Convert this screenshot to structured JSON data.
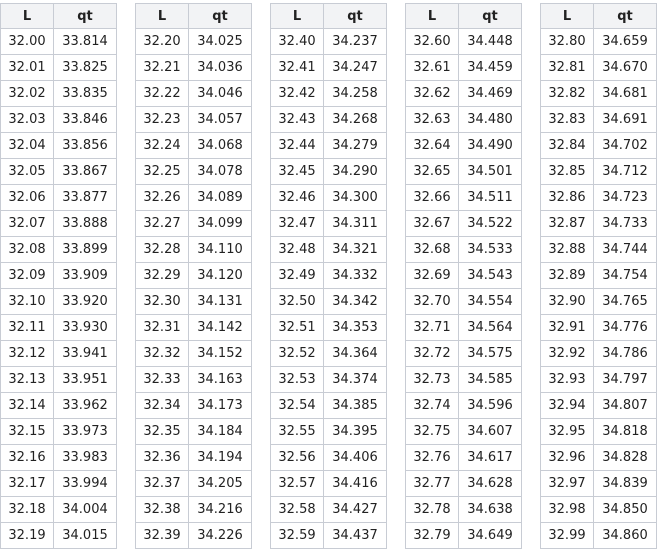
{
  "headers": {
    "l": "L",
    "qt": "qt"
  },
  "tables": [
    {
      "rows": [
        [
          "32.00",
          "33.814"
        ],
        [
          "32.01",
          "33.825"
        ],
        [
          "32.02",
          "33.835"
        ],
        [
          "32.03",
          "33.846"
        ],
        [
          "32.04",
          "33.856"
        ],
        [
          "32.05",
          "33.867"
        ],
        [
          "32.06",
          "33.877"
        ],
        [
          "32.07",
          "33.888"
        ],
        [
          "32.08",
          "33.899"
        ],
        [
          "32.09",
          "33.909"
        ],
        [
          "32.10",
          "33.920"
        ],
        [
          "32.11",
          "33.930"
        ],
        [
          "32.12",
          "33.941"
        ],
        [
          "32.13",
          "33.951"
        ],
        [
          "32.14",
          "33.962"
        ],
        [
          "32.15",
          "33.973"
        ],
        [
          "32.16",
          "33.983"
        ],
        [
          "32.17",
          "33.994"
        ],
        [
          "32.18",
          "34.004"
        ],
        [
          "32.19",
          "34.015"
        ]
      ]
    },
    {
      "rows": [
        [
          "32.20",
          "34.025"
        ],
        [
          "32.21",
          "34.036"
        ],
        [
          "32.22",
          "34.046"
        ],
        [
          "32.23",
          "34.057"
        ],
        [
          "32.24",
          "34.068"
        ],
        [
          "32.25",
          "34.078"
        ],
        [
          "32.26",
          "34.089"
        ],
        [
          "32.27",
          "34.099"
        ],
        [
          "32.28",
          "34.110"
        ],
        [
          "32.29",
          "34.120"
        ],
        [
          "32.30",
          "34.131"
        ],
        [
          "32.31",
          "34.142"
        ],
        [
          "32.32",
          "34.152"
        ],
        [
          "32.33",
          "34.163"
        ],
        [
          "32.34",
          "34.173"
        ],
        [
          "32.35",
          "34.184"
        ],
        [
          "32.36",
          "34.194"
        ],
        [
          "32.37",
          "34.205"
        ],
        [
          "32.38",
          "34.216"
        ],
        [
          "32.39",
          "34.226"
        ]
      ]
    },
    {
      "rows": [
        [
          "32.40",
          "34.237"
        ],
        [
          "32.41",
          "34.247"
        ],
        [
          "32.42",
          "34.258"
        ],
        [
          "32.43",
          "34.268"
        ],
        [
          "32.44",
          "34.279"
        ],
        [
          "32.45",
          "34.290"
        ],
        [
          "32.46",
          "34.300"
        ],
        [
          "32.47",
          "34.311"
        ],
        [
          "32.48",
          "34.321"
        ],
        [
          "32.49",
          "34.332"
        ],
        [
          "32.50",
          "34.342"
        ],
        [
          "32.51",
          "34.353"
        ],
        [
          "32.52",
          "34.364"
        ],
        [
          "32.53",
          "34.374"
        ],
        [
          "32.54",
          "34.385"
        ],
        [
          "32.55",
          "34.395"
        ],
        [
          "32.56",
          "34.406"
        ],
        [
          "32.57",
          "34.416"
        ],
        [
          "32.58",
          "34.427"
        ],
        [
          "32.59",
          "34.437"
        ]
      ]
    },
    {
      "rows": [
        [
          "32.60",
          "34.448"
        ],
        [
          "32.61",
          "34.459"
        ],
        [
          "32.62",
          "34.469"
        ],
        [
          "32.63",
          "34.480"
        ],
        [
          "32.64",
          "34.490"
        ],
        [
          "32.65",
          "34.501"
        ],
        [
          "32.66",
          "34.511"
        ],
        [
          "32.67",
          "34.522"
        ],
        [
          "32.68",
          "34.533"
        ],
        [
          "32.69",
          "34.543"
        ],
        [
          "32.70",
          "34.554"
        ],
        [
          "32.71",
          "34.564"
        ],
        [
          "32.72",
          "34.575"
        ],
        [
          "32.73",
          "34.585"
        ],
        [
          "32.74",
          "34.596"
        ],
        [
          "32.75",
          "34.607"
        ],
        [
          "32.76",
          "34.617"
        ],
        [
          "32.77",
          "34.628"
        ],
        [
          "32.78",
          "34.638"
        ],
        [
          "32.79",
          "34.649"
        ]
      ]
    },
    {
      "rows": [
        [
          "32.80",
          "34.659"
        ],
        [
          "32.81",
          "34.670"
        ],
        [
          "32.82",
          "34.681"
        ],
        [
          "32.83",
          "34.691"
        ],
        [
          "32.84",
          "34.702"
        ],
        [
          "32.85",
          "34.712"
        ],
        [
          "32.86",
          "34.723"
        ],
        [
          "32.87",
          "34.733"
        ],
        [
          "32.88",
          "34.744"
        ],
        [
          "32.89",
          "34.754"
        ],
        [
          "32.90",
          "34.765"
        ],
        [
          "32.91",
          "34.776"
        ],
        [
          "32.92",
          "34.786"
        ],
        [
          "32.93",
          "34.797"
        ],
        [
          "32.94",
          "34.807"
        ],
        [
          "32.95",
          "34.818"
        ],
        [
          "32.96",
          "34.828"
        ],
        [
          "32.97",
          "34.839"
        ],
        [
          "32.98",
          "34.850"
        ],
        [
          "32.99",
          "34.860"
        ]
      ]
    }
  ],
  "colors": {
    "border": "#c8ccd4",
    "header_bg": "#f2f3f5",
    "text": "#222222"
  }
}
